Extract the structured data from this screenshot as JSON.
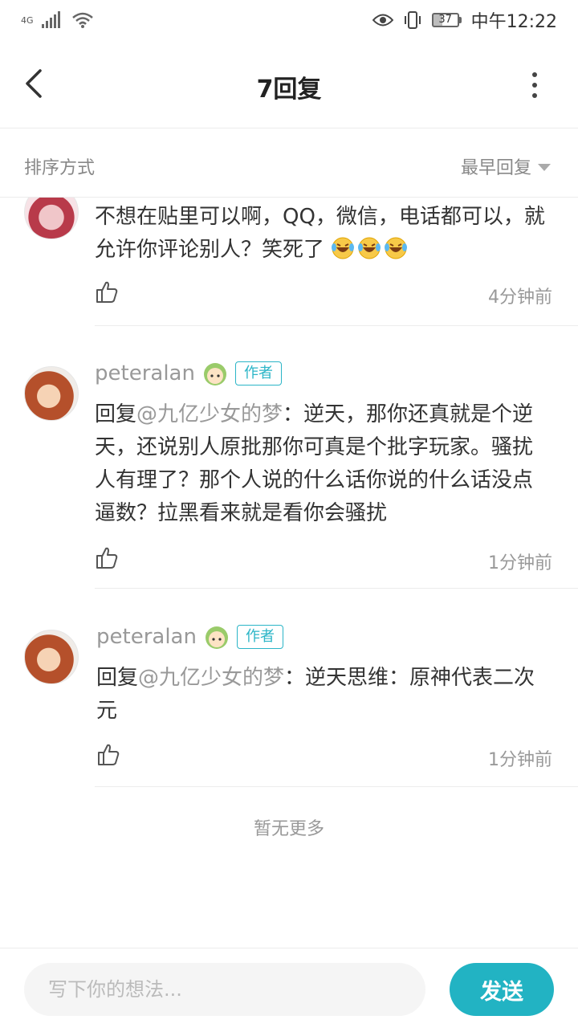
{
  "status_bar": {
    "network": "4G",
    "time": "中午12:22",
    "battery": "37",
    "icons": [
      "signal-icon",
      "wifi-icon",
      "eye-icon",
      "vibrate-icon",
      "battery-icon"
    ]
  },
  "header": {
    "title": "7回复",
    "back_icon": "chevron-left-icon",
    "more_icon": "more-vertical-icon"
  },
  "sort": {
    "label": "排序方式",
    "value": "最早回复"
  },
  "comments": [
    {
      "text": "不想在贴里可以啊，QQ，微信，电话都可以，就允许你评论别人？笑死了",
      "emojis": [
        "laughing-tears-emoji",
        "laughing-tears-emoji",
        "laughing-tears-emoji"
      ],
      "time": "4分钟前"
    },
    {
      "username": "peteralan",
      "author_tag": "作者",
      "reply_prefix": "回复",
      "mention": "@九亿少女的梦",
      "text": "：逆天，那你还真就是个逆天，还说别人原批那你可真是个批字玩家。骚扰人有理了？那个人说的什么话你说的什么话没点逼数？拉黑看来就是看你会骚扰",
      "time": "1分钟前"
    },
    {
      "username": "peteralan",
      "author_tag": "作者",
      "reply_prefix": "回复",
      "mention": "@九亿少女的梦",
      "text": "：逆天思维：原神代表二次元",
      "time": "1分钟前"
    }
  ],
  "no_more": "暂无更多",
  "composer": {
    "placeholder": "写下你的想法...",
    "send_label": "发送"
  },
  "colors": {
    "accent": "#22b3c3",
    "author_tag": "#2bb5c7",
    "muted_text": "#999999"
  }
}
